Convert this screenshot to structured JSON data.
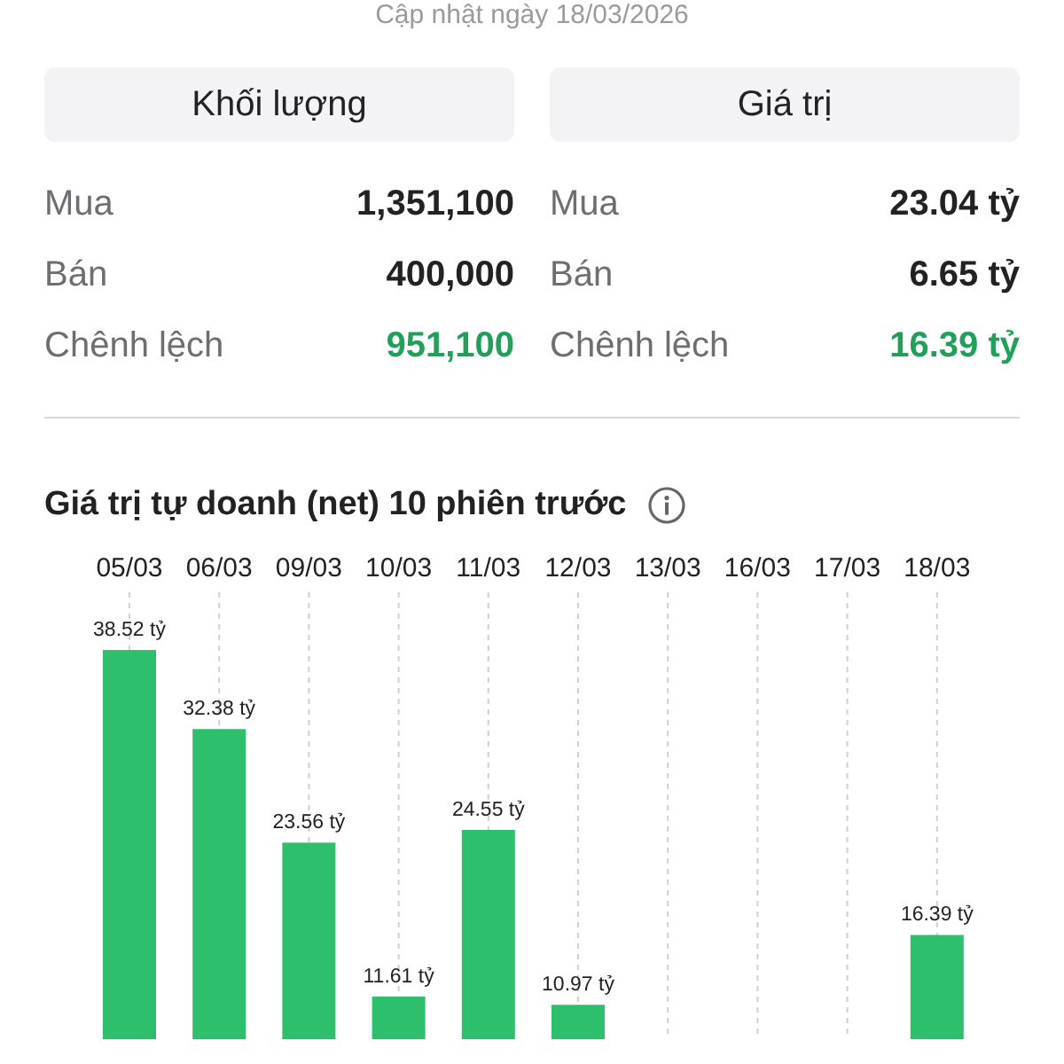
{
  "update_note": "Cập nhật ngày 18/03/2026",
  "panels": [
    {
      "title": "Khối lượng",
      "rows": [
        {
          "label": "Mua",
          "value": "1,351,100",
          "kind": "plain"
        },
        {
          "label": "Bán",
          "value": "400,000",
          "kind": "plain"
        },
        {
          "label": "Chênh lệch",
          "value": "951,100",
          "kind": "positive"
        }
      ]
    },
    {
      "title": "Giá trị",
      "rows": [
        {
          "label": "Mua",
          "value": "23.04 tỷ",
          "kind": "plain"
        },
        {
          "label": "Bán",
          "value": "6.65 tỷ",
          "kind": "plain"
        },
        {
          "label": "Chênh lệch",
          "value": "16.39 tỷ",
          "kind": "positive"
        }
      ]
    }
  ],
  "chart": {
    "chart_data": {
      "type": "bar",
      "title": "Giá trị tự doanh (net) 10 phiên trước",
      "categories": [
        "05/03",
        "06/03",
        "09/03",
        "10/03",
        "11/03",
        "12/03",
        "13/03",
        "16/03",
        "17/03",
        "18/03"
      ],
      "values": [
        38.52,
        32.38,
        23.56,
        11.61,
        24.55,
        10.97,
        null,
        null,
        null,
        16.39
      ],
      "data_labels": true,
      "grid": true,
      "ylim": [
        8.3,
        43
      ],
      "value_labels": [
        "38.52 tỷ",
        "32.38 tỷ",
        "23.56 tỷ",
        "11.61 tỷ",
        "24.55 tỷ",
        "10.97 tỷ",
        null,
        null,
        null,
        "16.39 tỷ"
      ]
    }
  }
}
